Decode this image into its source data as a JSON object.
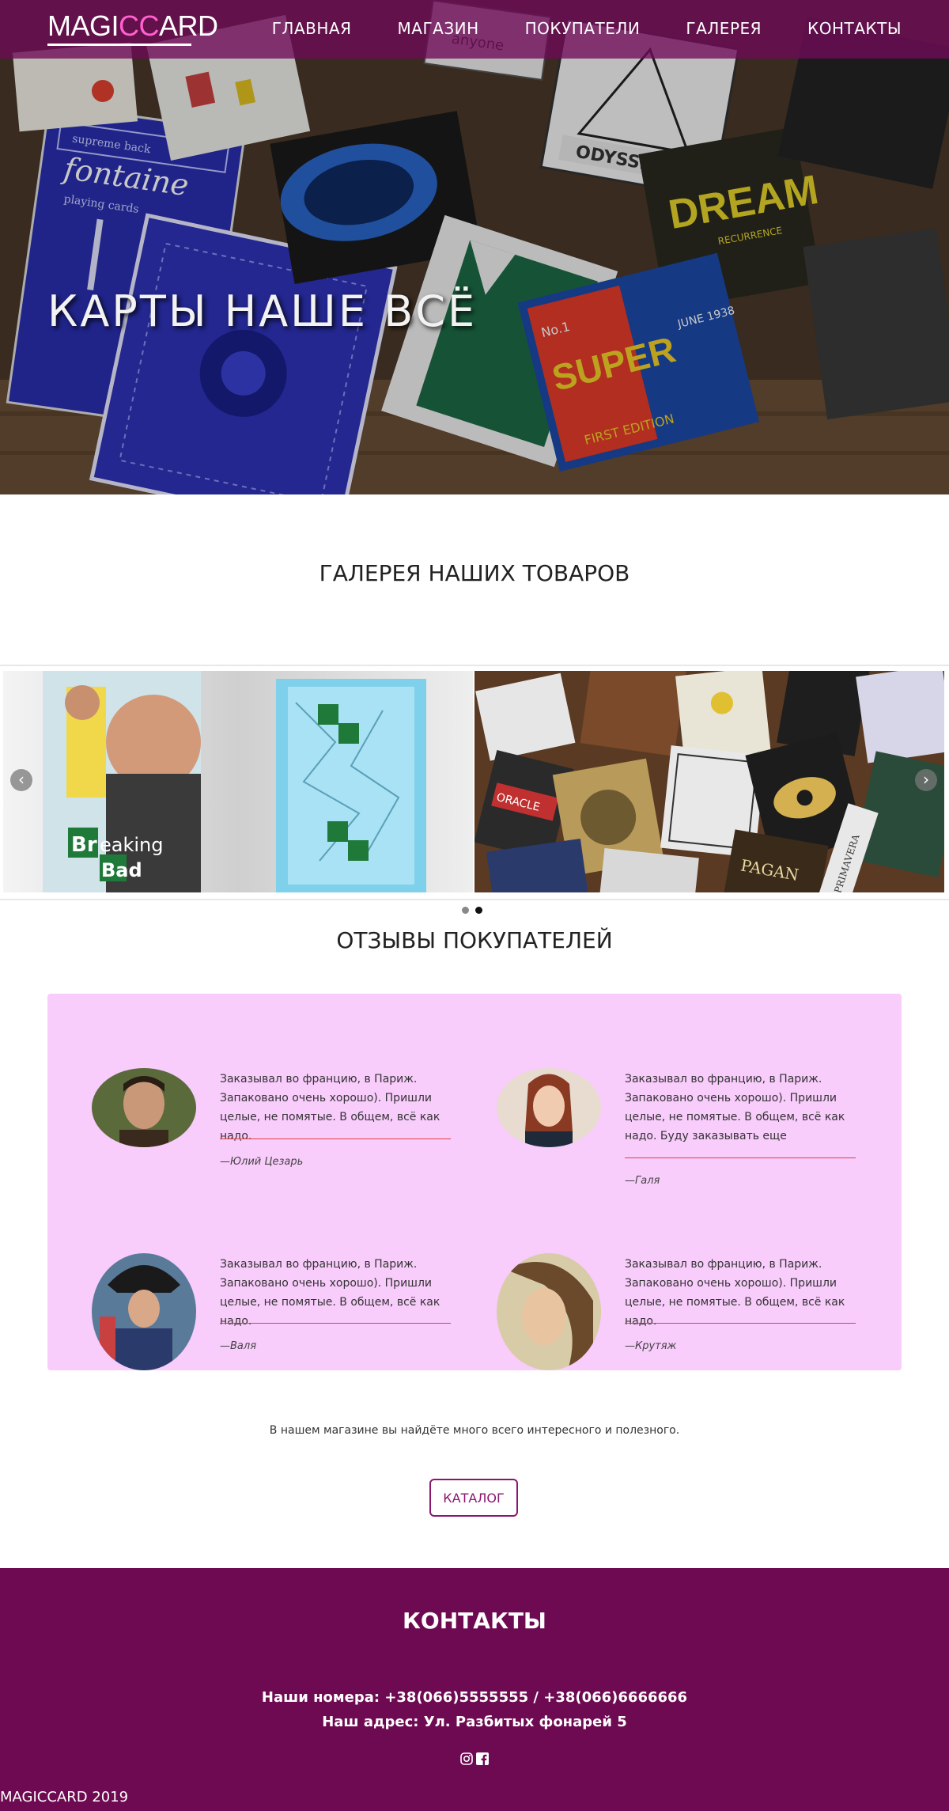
{
  "header": {
    "logo": {
      "part1": "MAGI",
      "part2": "CC",
      "part3": "ARD"
    },
    "nav": [
      {
        "label": "ГЛАВНАЯ"
      },
      {
        "label": "МАГАЗИН"
      },
      {
        "label": "ПОКУПАТЕЛИ"
      },
      {
        "label": "ГАЛЕРЕЯ"
      },
      {
        "label": "КОНТАКТЫ"
      }
    ]
  },
  "hero": {
    "title": "КАРТЫ НАШЕ ВСЁ",
    "card_labels": {
      "fontaine": "fontaine",
      "supreme": "supreme back",
      "playing": "playing cards",
      "odyssey": "ODYSSEY",
      "dream": "DREAM",
      "recurrence": "RECURRENCE",
      "super": "SUPER",
      "no": "No.1",
      "first": "FIRST EDITION",
      "june": "JUNE 1938",
      "anyone": "anyone"
    }
  },
  "gallery": {
    "title": "ГАЛЕРЕЯ НАШИХ ТОВАРОВ",
    "slide1_text": {
      "br": "Br",
      "eaking": "eaking",
      "bad": "Bad"
    },
    "slide2_labels": {
      "pagan": "PAGAN",
      "primavera": "PRIMAVERA",
      "oracle": "ORACLE"
    },
    "prev": "‹",
    "next": "›",
    "dots": 2,
    "active_dot": 1
  },
  "reviews": {
    "title": "ОТЗЫВЫ ПОКУПАТЕЛЕЙ",
    "items": [
      {
        "text": "Заказывал во францию, в Париж. Запаковано очень хорошо). Пришли целые, не помятые. В общем, всё как надо.",
        "author": "—Юлий Цезарь"
      },
      {
        "text": "Заказывал во францию, в Париж. Запаковано очень хорошо). Пришли целые, не помятые. В общем, всё как надо. Буду заказывать еще",
        "author": "—Галя"
      },
      {
        "text": "Заказывал во францию, в Париж. Запаковано очень хорошо). Пришли целые, не помятые. В общем, всё как надо.",
        "author": "—Валя"
      },
      {
        "text": "Заказывал во францию, в Париж. Запаковано очень хорошо). Пришли целые, не помятые. В общем, всё как надо.",
        "author": "—Крутяж"
      }
    ]
  },
  "promo": {
    "text": "В нашем магазине вы найдёте много всего интересного и полезного.",
    "button": "КАТАЛОГ"
  },
  "footer": {
    "title": "КОНТАКТЫ",
    "phones": "Наши номера: +38(066)5555555 / +38(066)6666666",
    "address": "Наш адрес: Ул. Разбитых фонарей 5",
    "social": [
      "instagram-icon",
      "facebook-icon"
    ],
    "copyright": "MAGICCARD 2019"
  },
  "colors": {
    "brand": "#6e0a51",
    "nav_bg": "#700a58",
    "reviews_bg": "#f8ccfb",
    "accent_pink": "#ff5fcf",
    "divider": "#e0413f"
  }
}
